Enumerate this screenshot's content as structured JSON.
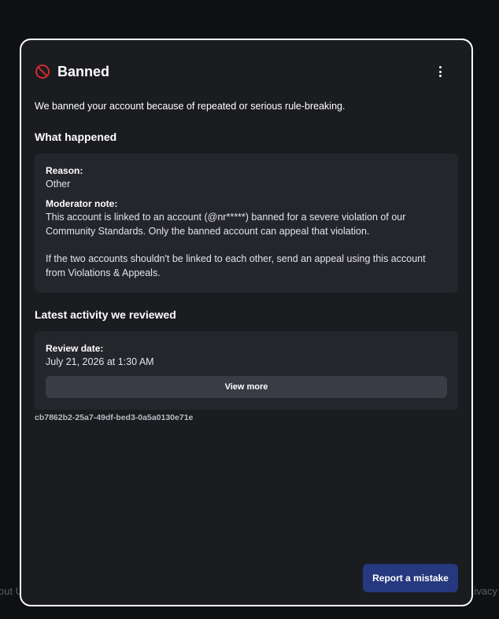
{
  "background": {
    "left_text": "out U",
    "right_text": "ivacy"
  },
  "modal": {
    "title": "Banned",
    "intro": "We banned your account because of repeated or serious rule-breaking.",
    "what_happened": {
      "heading": "What happened",
      "reason_label": "Reason:",
      "reason_value": "Other",
      "note_label": "Moderator note:",
      "note_line1": "This account is linked to an account (@nr*****) banned for a severe violation of our",
      "note_line2": "Community Standards. Only the banned account can appeal that violation.",
      "note_line3": "If the two accounts shouldn't be linked to each other, send an appeal using this account",
      "note_line4": "from Violations & Appeals."
    },
    "latest_activity": {
      "heading": "Latest activity we reviewed",
      "review_label": "Review date:",
      "review_value": "July 21, 2026 at 1:30 AM",
      "view_more_label": "View more"
    },
    "reference_id": "cb7862b2-25a7-49df-bed3-0a5a0130e71e",
    "report_button_label": "Report a mistake"
  },
  "icons": {
    "ban": "ban-icon",
    "more": "more-vertical-icon"
  },
  "colors": {
    "ban_icon": "#e02e2e",
    "primary_button": "#26387e",
    "modal_bg": "#1b1c20",
    "card_bg": "#25262b"
  }
}
